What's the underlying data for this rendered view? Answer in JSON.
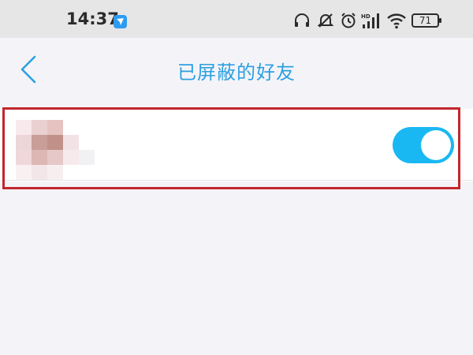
{
  "status_bar": {
    "time": "14:37",
    "battery": "71",
    "icons": [
      "app-notification-icon",
      "headphones-icon",
      "mute-icon",
      "alarm-icon",
      "hd-signal-icon",
      "wifi-icon",
      "battery-icon"
    ]
  },
  "nav": {
    "title": "已屏蔽的好友",
    "back_icon": "back-chevron-icon"
  },
  "friends": [
    {
      "avatar": "blurred-avatar",
      "name": "",
      "shielded": true
    }
  ],
  "colors": {
    "accent": "#1ab8f2",
    "title": "#2d9fe2",
    "highlight": "#c1272d",
    "background": "#f4f4f8"
  }
}
